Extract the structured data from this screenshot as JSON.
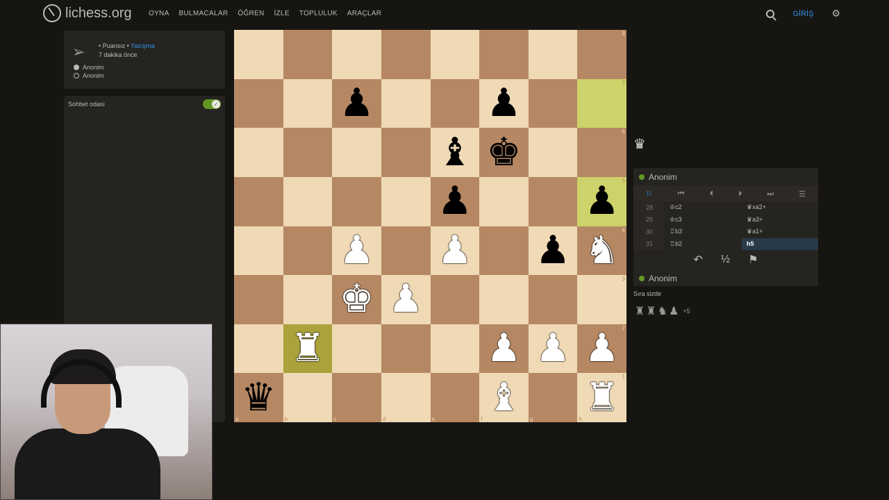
{
  "header": {
    "site_name": "lichess.org",
    "nav": [
      "OYNA",
      "BULMACALAR",
      "ÖĞREN",
      "İZLE",
      "TOPLULUK",
      "ARAÇLAR"
    ],
    "login_label": "GİRİŞ"
  },
  "game_info": {
    "rating_mode": "• Puansız •",
    "variant_link": "Yazışma",
    "time_ago": "7 dakika önce",
    "white_player": "Anonim",
    "black_player": "Anonim"
  },
  "chat": {
    "title": "Sohbet odası",
    "enabled": true
  },
  "board": {
    "ranks": [
      "8",
      "7",
      "6",
      "5",
      "4",
      "3",
      "2",
      "1"
    ],
    "files": [
      "a",
      "b",
      "c",
      "d",
      "e",
      "f",
      "g",
      "h"
    ],
    "highlights": [
      "h7",
      "h5",
      "b2"
    ],
    "pieces": {
      "c7": "bp",
      "f7": "bp",
      "e6": "bb",
      "f6": "bk",
      "e5": "bp",
      "h5": "bp",
      "c4": "wp",
      "e4": "wp",
      "g4": "bp",
      "h4": "wn",
      "c3": "wk",
      "d3": "wp",
      "b2": "wr",
      "f2": "wp",
      "g2": "wp",
      "h2": "wp",
      "a1": "bq",
      "f1": "wb",
      "h1": "wr"
    }
  },
  "captured_icon": "♛",
  "panel": {
    "top_player": "Anonim",
    "bottom_player": "Anonim",
    "controls": [
      "⚐",
      "⏮",
      "⏴",
      "⏵",
      "⏭",
      "☰"
    ],
    "moves": [
      {
        "num": "28",
        "white": "♔c2",
        "black": "♛xa2+"
      },
      {
        "num": "29",
        "white": "♔c3",
        "black": "♛a3+"
      },
      {
        "num": "30",
        "white": "♖b3",
        "black": "♛a1+"
      },
      {
        "num": "31",
        "white": "♖b2",
        "black": "h5"
      }
    ],
    "actions": [
      "↶",
      "½",
      "⚑"
    ]
  },
  "status": {
    "your_turn": "Sıra sizde",
    "material_icons": [
      "♜",
      "♜",
      "♞",
      "♟"
    ],
    "material_advantage": "+5"
  }
}
